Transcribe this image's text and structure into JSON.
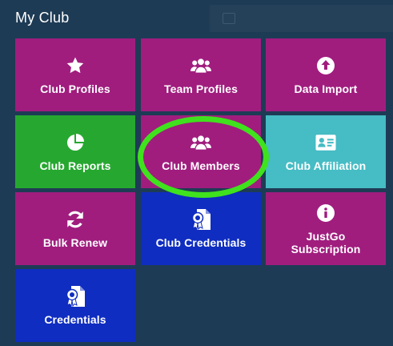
{
  "panel": {
    "title": "My Club"
  },
  "colors": {
    "background": "#1e3b55",
    "magenta": "#a01d7e",
    "green": "#26a830",
    "teal": "#46bcc4",
    "blue": "#0f2dc0",
    "highlight": "#3fe21d"
  },
  "tiles": [
    {
      "label": "Club Profiles",
      "icon": "star-icon",
      "color": "#a01d7e"
    },
    {
      "label": "Team Profiles",
      "icon": "users-icon",
      "color": "#a01d7e"
    },
    {
      "label": "Data Import",
      "icon": "upload-circle-icon",
      "color": "#a01d7e"
    },
    {
      "label": "Club Reports",
      "icon": "pie-chart-icon",
      "color": "#26a830"
    },
    {
      "label": "Club Members",
      "icon": "users-icon",
      "color": "#a01d7e"
    },
    {
      "label": "Club Affiliation",
      "icon": "id-card-icon",
      "color": "#46bcc4"
    },
    {
      "label": "Bulk Renew",
      "icon": "refresh-icon",
      "color": "#a01d7e"
    },
    {
      "label": "Club Credentials",
      "icon": "credential-document-icon",
      "color": "#0f2dc0"
    },
    {
      "label": "JustGo\nSubscription",
      "icon": "info-circle-icon",
      "color": "#a01d7e"
    },
    {
      "label": "Credentials",
      "icon": "credential-document-icon",
      "color": "#0f2dc0"
    }
  ]
}
